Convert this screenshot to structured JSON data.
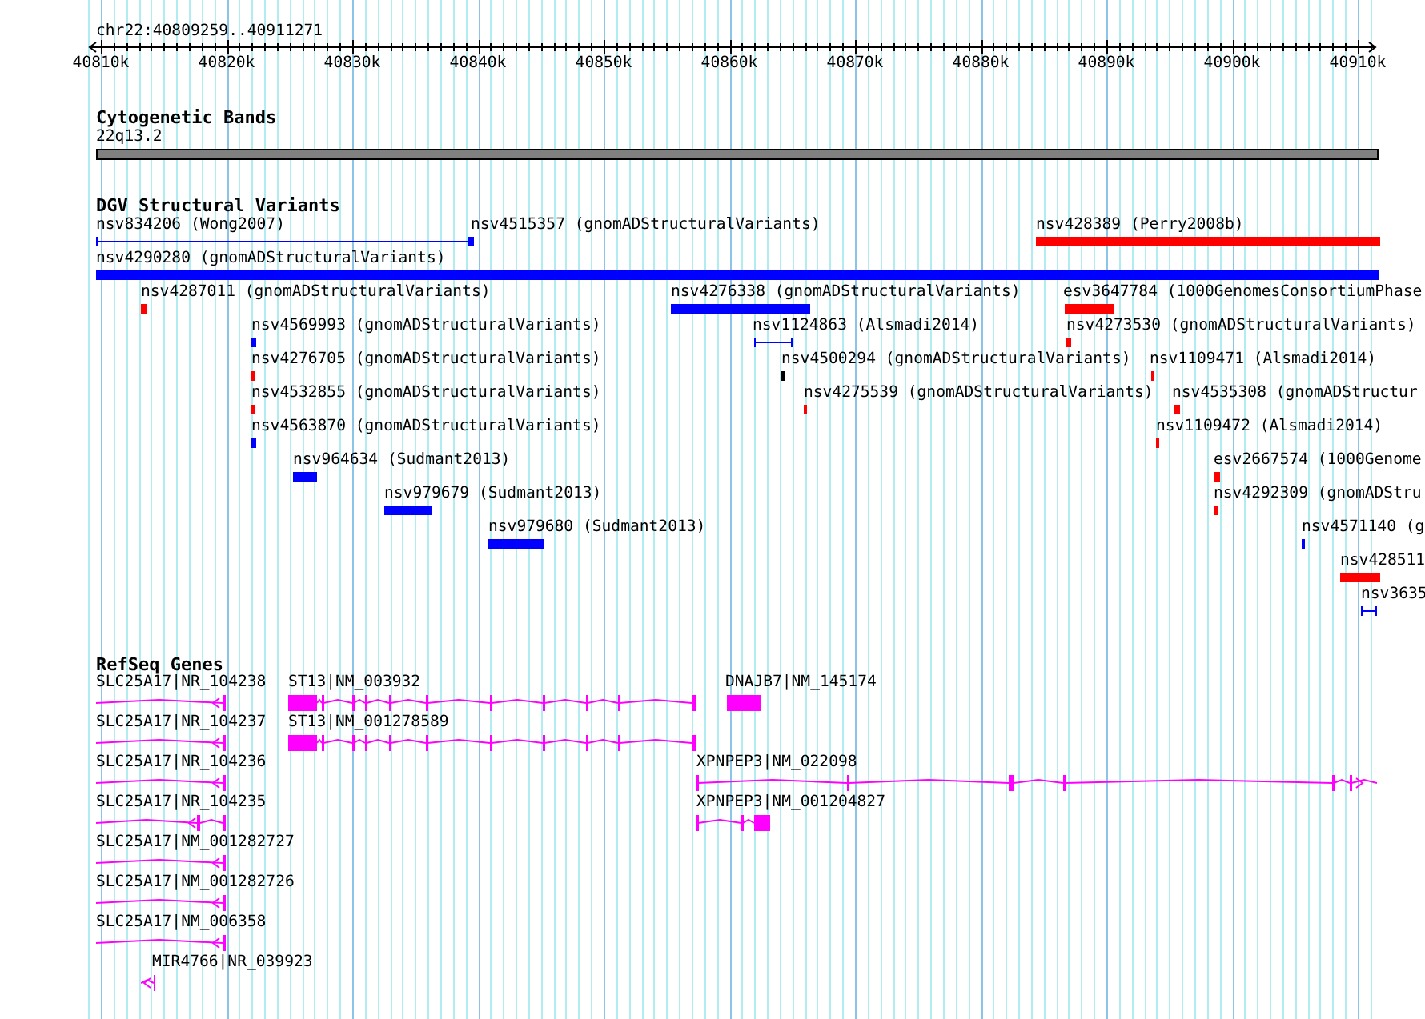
{
  "ruler": {
    "location": "chr22:40809259..40911271",
    "ticks": [
      "40810k",
      "40820k",
      "40830k",
      "40840k",
      "40850k",
      "40860k",
      "40870k",
      "40880k",
      "40890k",
      "40900k",
      "40910k"
    ]
  },
  "tracks": [
    {
      "kind": "cytoband",
      "title": "Cytogenetic Bands",
      "band": {
        "label": "22q13.2"
      }
    },
    {
      "kind": "variants",
      "title": "DGV Structural Variants",
      "features": [
        {
          "label": "nsv834206 (Wong2007)",
          "kind": "span",
          "color": "#0000ff"
        },
        {
          "label": "nsv4515357 (gnomADStructuralVariants)",
          "kind": "block",
          "color": "#0000ff"
        },
        {
          "label": "nsv428389 (Perry2008b)",
          "kind": "block",
          "color": "#ff0000"
        },
        {
          "label": "nsv4290280 (gnomADStructuralVariants)",
          "kind": "block",
          "color": "#0000ff"
        },
        {
          "label": "nsv4287011 (gnomADStructuralVariants)",
          "kind": "block",
          "color": "#ff0000"
        },
        {
          "label": "nsv4276338 (gnomADStructuralVariants)",
          "kind": "block",
          "color": "#0000ff"
        },
        {
          "label": "esv3647784 (1000GenomesConsortiumPhase",
          "kind": "block",
          "color": "#ff0000"
        },
        {
          "label": "nsv4569993 (gnomADStructuralVariants)",
          "kind": "block",
          "color": "#0000ff"
        },
        {
          "label": "nsv1124863 (Alsmadi2014)",
          "kind": "span",
          "color": "#0000ff"
        },
        {
          "label": "nsv4273530 (gnomADStructuralVariants)",
          "kind": "block",
          "color": "#ff0000"
        },
        {
          "label": "nsv4276705 (gnomADStructuralVariants)",
          "kind": "block",
          "color": "#ff0000"
        },
        {
          "label": "nsv4500294 (gnomADStructuralVariants)",
          "kind": "block",
          "color": "#000000"
        },
        {
          "label": "nsv1109471 (Alsmadi2014)",
          "kind": "block",
          "color": "#ff0000"
        },
        {
          "label": "nsv4532855 (gnomADStructuralVariants)",
          "kind": "block",
          "color": "#ff0000"
        },
        {
          "label": "nsv4275539 (gnomADStructuralVariants)",
          "kind": "block",
          "color": "#ff0000"
        },
        {
          "label": "nsv4535308 (gnomADStructur",
          "kind": "block",
          "color": "#ff0000"
        },
        {
          "label": "nsv4563870 (gnomADStructuralVariants)",
          "kind": "block",
          "color": "#0000ff"
        },
        {
          "label": "nsv1109472 (Alsmadi2014)",
          "kind": "block",
          "color": "#ff0000"
        },
        {
          "label": "nsv964634 (Sudmant2013)",
          "kind": "block",
          "color": "#0000ff"
        },
        {
          "label": "esv2667574 (1000Genome",
          "kind": "block",
          "color": "#ff0000"
        },
        {
          "label": "nsv979679 (Sudmant2013)",
          "kind": "block",
          "color": "#0000ff"
        },
        {
          "label": "nsv4292309 (gnomADStru",
          "kind": "block",
          "color": "#ff0000"
        },
        {
          "label": "nsv979680 (Sudmant2013)",
          "kind": "block",
          "color": "#0000ff"
        },
        {
          "label": "nsv4571140 (g",
          "kind": "block",
          "color": "#0000ff"
        },
        {
          "label": "nsv428511",
          "kind": "block",
          "color": "#ff0000"
        },
        {
          "label": "nsv3635",
          "kind": "span",
          "color": "#0000ff"
        }
      ]
    },
    {
      "kind": "genes",
      "title": "RefSeq Genes",
      "genes": [
        {
          "label": "SLC25A17|NR_104238"
        },
        {
          "label": "ST13|NM_003932"
        },
        {
          "label": "DNAJB7|NM_145174"
        },
        {
          "label": "SLC25A17|NR_104237"
        },
        {
          "label": "ST13|NM_001278589"
        },
        {
          "label": "SLC25A17|NR_104236"
        },
        {
          "label": "XPNPEP3|NM_022098"
        },
        {
          "label": "SLC25A17|NR_104235"
        },
        {
          "label": "XPNPEP3|NM_001204827"
        },
        {
          "label": "SLC25A17|NM_001282727"
        },
        {
          "label": "SLC25A17|NM_001282726"
        },
        {
          "label": "SLC25A17|NM_006358"
        },
        {
          "label": "MIR4766|NR_039923"
        }
      ]
    }
  ]
}
